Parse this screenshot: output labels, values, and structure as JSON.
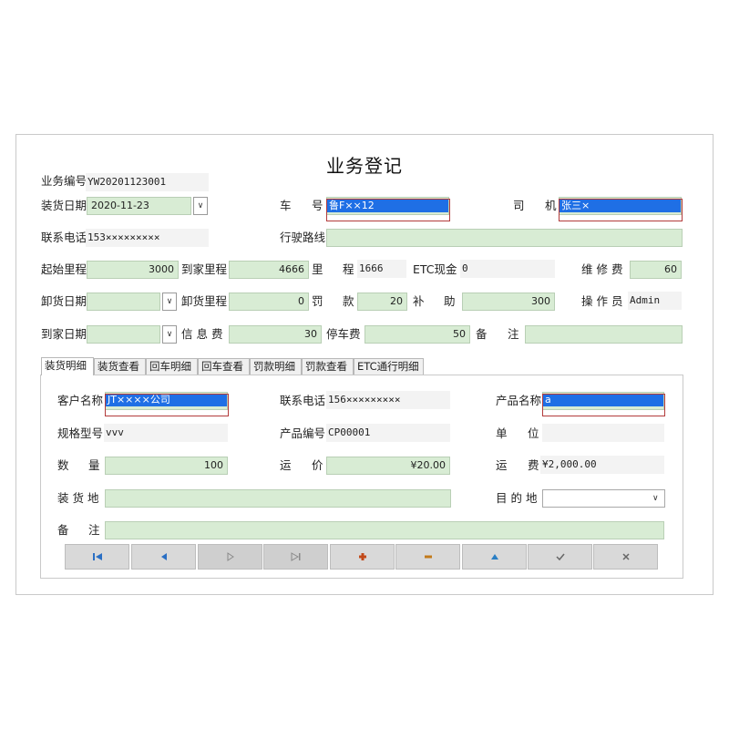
{
  "form": {
    "title": "业务登记",
    "biz_no_label": "业务编号",
    "biz_no_value": "YW20201123001",
    "load_date_label": "装货日期",
    "load_date_value": "2020-11-23",
    "plate_label_1": "车",
    "plate_label_2": "号",
    "plate_value": "鲁F××12",
    "driver_label_1": "司",
    "driver_label_2": "机",
    "driver_value": "张三×",
    "phone_label": "联系电话",
    "phone_value": "153×××××××××",
    "route_label": "行驶路线",
    "route_value": "",
    "start_km_label": "起始里程",
    "start_km_value": "3000",
    "home_km_label": "到家里程",
    "home_km_value": "4666",
    "km_label_1": "里",
    "km_label_2": "程",
    "km_value": "1666",
    "etc_cash_label": "ETC现金",
    "etc_cash_value": "0",
    "repair_label": "维 修 费",
    "repair_value": "60",
    "unload_date_label": "卸货日期",
    "unload_date_value": "",
    "unload_km_label": "卸货里程",
    "unload_km_value": "0",
    "fine_label_1": "罚",
    "fine_label_2": "款",
    "fine_value": "20",
    "subsidy_label_1": "补",
    "subsidy_label_2": "助",
    "subsidy_value": "300",
    "operator_label": "操 作 员",
    "operator_value": "Admin",
    "home_date_label": "到家日期",
    "home_date_value": "",
    "info_fee_label": "信 息 费",
    "info_fee_value": "30",
    "parking_label": "停车费",
    "parking_value": "50",
    "remark_label_1": "备",
    "remark_label_2": "注",
    "remark_value": ""
  },
  "tabs": [
    "装货明细",
    "装货查看",
    "回车明细",
    "回车查看",
    "罚款明细",
    "罚款查看",
    "ETC通行明细"
  ],
  "detail": {
    "customer_label": "客户名称",
    "customer_value": "JT××××公司",
    "contact_phone_label": "联系电话",
    "contact_phone_value": "156×××××××××",
    "product_name_label": "产品名称",
    "product_name_value": "a",
    "spec_label": "规格型号",
    "spec_value": "vvv",
    "product_no_label": "产品编号",
    "product_no_value": "CP00001",
    "unit_label_1": "单",
    "unit_label_2": "位",
    "unit_value": "",
    "qty_label_1": "数",
    "qty_label_2": "量",
    "qty_value": "100",
    "price_label_1": "运",
    "price_label_2": "价",
    "price_value": "¥20.00",
    "freight_label_1": "运",
    "freight_label_2": "费",
    "freight_value": "¥2,000.00",
    "load_place_label": "装 货 地",
    "load_place_value": "",
    "dest_label": "目 的 地",
    "dest_value": "",
    "remark_label_1": "备",
    "remark_label_2": "注",
    "remark_value": ""
  },
  "nav": {
    "first": "first-record-icon",
    "prev": "prev-record-icon",
    "next": "next-record-icon",
    "last": "last-record-icon",
    "add": "add-icon",
    "delete": "delete-icon",
    "edit": "edit-icon",
    "save": "confirm-icon",
    "cancel": "cancel-icon"
  },
  "colors": {
    "field_green": "#d8ecd4",
    "selection_blue": "#1f6fe5",
    "highlight_red": "#b33b3b"
  }
}
